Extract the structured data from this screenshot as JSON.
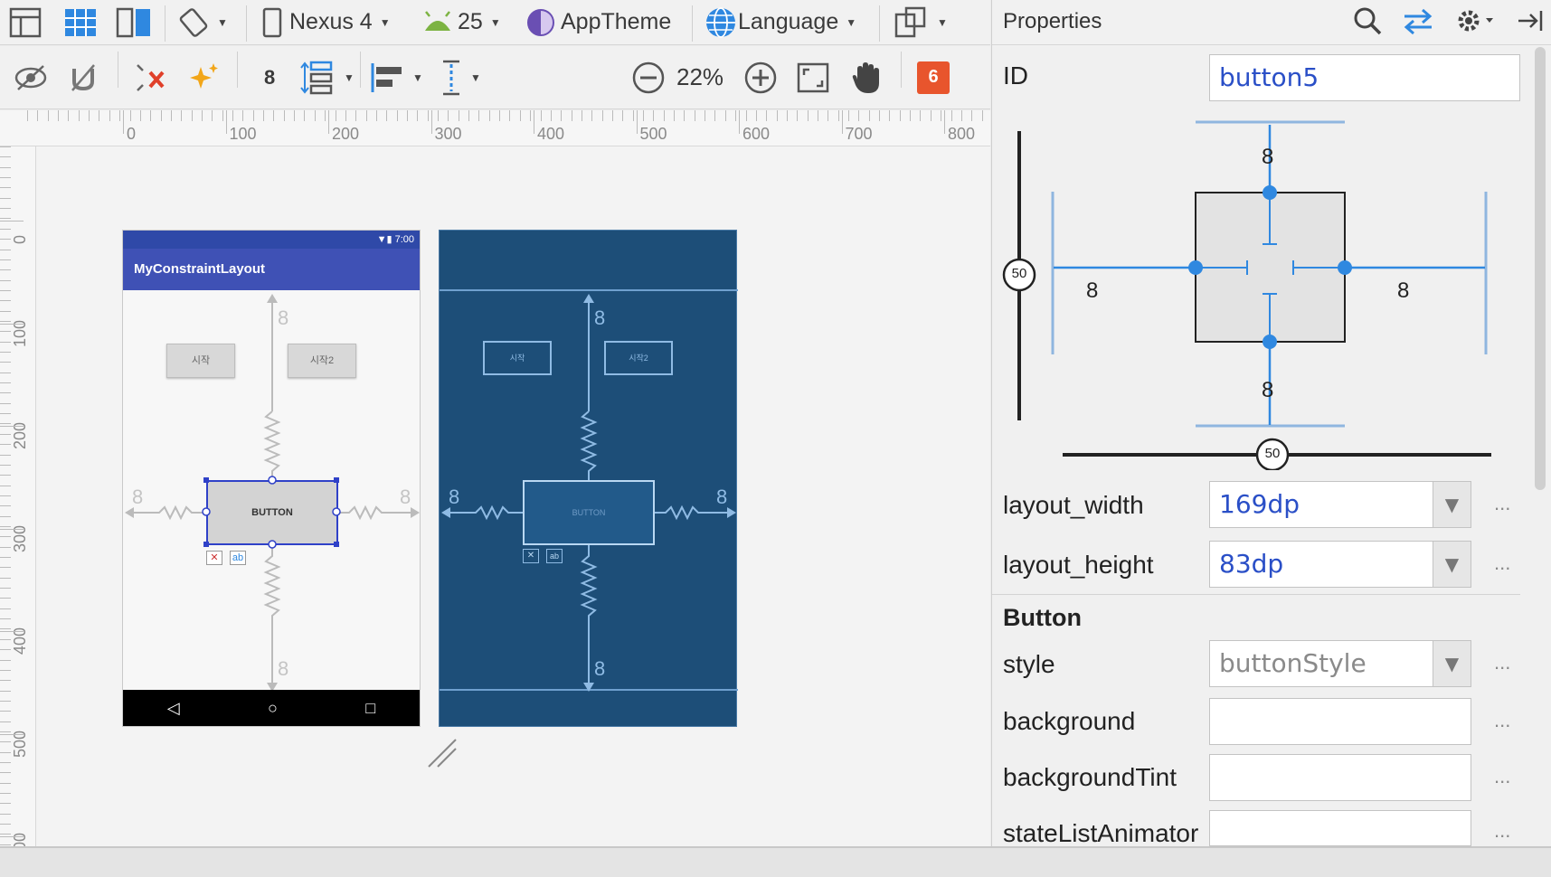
{
  "toolbar1": {
    "device": "Nexus 4",
    "api": "25",
    "theme": "AppTheme",
    "language": "Language"
  },
  "toolbar2": {
    "margin": "8",
    "zoom": "22%",
    "issues": "6"
  },
  "ruler": {
    "h_labels": [
      "0",
      "100",
      "200",
      "300",
      "400",
      "500",
      "600",
      "700",
      "800"
    ],
    "v_labels": [
      "0",
      "100",
      "200",
      "300",
      "400",
      "500",
      "600"
    ]
  },
  "design": {
    "status_time": "7:00",
    "app_title": "MyConstraintLayout",
    "btn1": "시작",
    "btn2": "시작2",
    "button_text": "BUTTON",
    "margin_label": "8",
    "nav_back": "◁",
    "nav_home": "○",
    "nav_recent": "□"
  },
  "blueprint": {
    "btn1": "시작",
    "btn2": "시작2",
    "button_text": "BUTTON",
    "margin_label": "8"
  },
  "properties": {
    "title": "Properties",
    "id_label": "ID",
    "id_value": "button5",
    "inspector": {
      "top": "8",
      "bottom": "8",
      "left": "8",
      "right": "8",
      "bias_v": "50",
      "bias_h": "50"
    },
    "layout_width_label": "layout_width",
    "layout_width_value": "169dp",
    "layout_height_label": "layout_height",
    "layout_height_value": "83dp",
    "section": "Button",
    "style_label": "style",
    "style_value": "buttonStyle",
    "background_label": "background",
    "background_value": "",
    "background_tint_label": "backgroundTint",
    "background_tint_value": "",
    "state_list_animator_label": "stateListAnimator",
    "state_list_animator_value": "",
    "more": "..."
  },
  "colors": {
    "accent_blue": "#2f7fd8",
    "app_bar": "#3f51b5",
    "blueprint_bg": "#1d4e78",
    "issue_badge": "#e8552d",
    "field_text": "#2a4fc7"
  }
}
